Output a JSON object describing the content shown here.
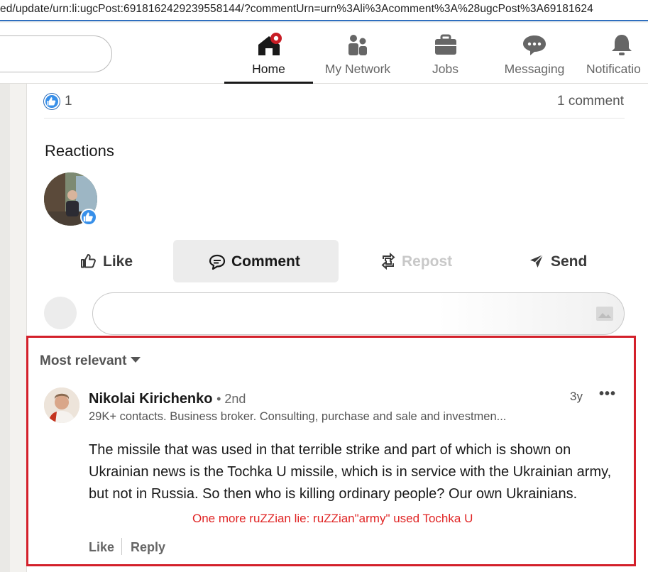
{
  "browser": {
    "url": "ed/update/urn:li:ugcPost:6918162429239558144/?commentUrn=urn%3Ali%3Acomment%3A%28ugcPost%3A69181624"
  },
  "nav": {
    "items": [
      {
        "label": "Home",
        "icon": "home-icon",
        "active": true
      },
      {
        "label": "My Network",
        "icon": "network-icon"
      },
      {
        "label": "Jobs",
        "icon": "briefcase-icon"
      },
      {
        "label": "Messaging",
        "icon": "messaging-icon"
      },
      {
        "label": "Notificatio",
        "icon": "bell-icon"
      }
    ],
    "accent": "#c81d25"
  },
  "post": {
    "reaction_count": "1",
    "comment_count": "1 comment",
    "reactions_title": "Reactions",
    "actions": {
      "like": "Like",
      "comment": "Comment",
      "repost": "Repost",
      "send": "Send"
    }
  },
  "comments": {
    "sort_label": "Most relevant",
    "items": [
      {
        "author": "Nikolai Kirichenko",
        "degree": "• 2nd",
        "headline": "29K+ contacts. Business broker. Consulting, purchase and sale and investmen...",
        "time": "3y",
        "more": "•••",
        "text": "The missile that was used in that terrible strike and part of which is shown on Ukrainian news is the Tochka U missile, which is in service with the Ukrainian army, but not in Russia. So then who is killing ordinary people? Our own Ukrainians.",
        "like_label": "Like",
        "reply_label": "Reply"
      }
    ]
  },
  "annotation": {
    "text": "One more ruZZian lie: ruZZian\"army\" used Tochka U",
    "color": "#e02424"
  },
  "colors": {
    "highlight_box": "#d3202a",
    "like_blue": "#378fe9"
  }
}
